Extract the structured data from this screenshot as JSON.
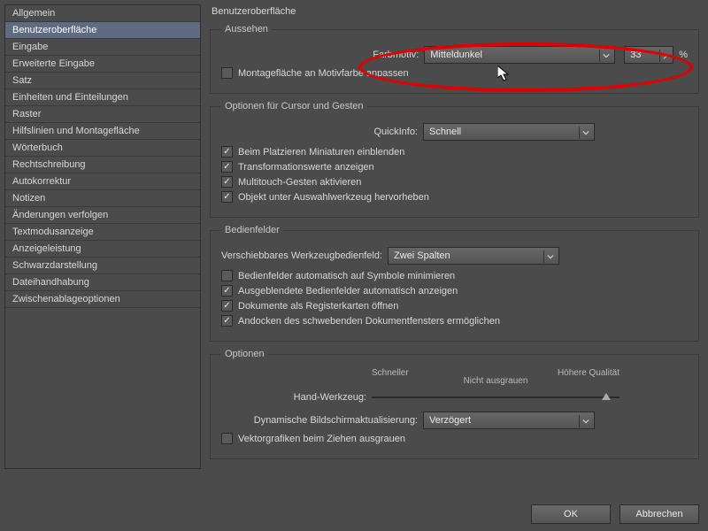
{
  "sidebar": {
    "items": [
      "Allgemein",
      "Benutzeroberfläche",
      "Eingabe",
      "Erweiterte Eingabe",
      "Satz",
      "Einheiten und Einteilungen",
      "Raster",
      "Hilfslinien und Montagefläche",
      "Wörterbuch",
      "Rechtschreibung",
      "Autokorrektur",
      "Notizen",
      "Änderungen verfolgen",
      "Textmodusanzeige",
      "Anzeigeleistung",
      "Schwarzdarstellung",
      "Dateihandhabung",
      "Zwischenablageoptionen"
    ],
    "selected_index": 1
  },
  "page_title": "Benutzeroberfläche",
  "appearance": {
    "legend": "Aussehen",
    "color_theme_label": "Farbmotiv:",
    "color_theme_value": "Mitteldunkel",
    "brightness_value": "33",
    "brightness_unit": "%",
    "match_pasteboard_label": "Montagefläche an Motivfarbe anpassen",
    "match_pasteboard_checked": false
  },
  "cursor": {
    "legend": "Optionen für Cursor und Gesten",
    "quickinfo_label": "QuickInfo:",
    "quickinfo_value": "Schnell",
    "checks": [
      {
        "label": "Beim Platzieren Miniaturen einblenden",
        "checked": true
      },
      {
        "label": "Transformationswerte anzeigen",
        "checked": true
      },
      {
        "label": "Multitouch-Gesten aktivieren",
        "checked": true
      },
      {
        "label": "Objekt unter Auswahlwerkzeug hervorheben",
        "checked": true
      }
    ]
  },
  "panels": {
    "legend": "Bedienfelder",
    "toolbar_label": "Verschiebbares Werkzeugbedienfeld:",
    "toolbar_value": "Zwei Spalten",
    "checks": [
      {
        "label": "Bedienfelder automatisch auf Symbole minimieren",
        "checked": false
      },
      {
        "label": "Ausgeblendete Bedienfelder automatisch anzeigen",
        "checked": true
      },
      {
        "label": "Dokumente als Registerkarten öffnen",
        "checked": true
      },
      {
        "label": "Andocken des schwebenden Dokumentfensters ermöglichen",
        "checked": true
      }
    ]
  },
  "options": {
    "legend": "Optionen",
    "slider_left": "Schneller",
    "slider_right": "Höhere Qualität",
    "slider_sub": "Nicht ausgrauen",
    "hand_tool_label": "Hand-Werkzeug:",
    "dynamic_label": "Dynamische Bildschirmaktualisierung:",
    "dynamic_value": "Verzögert",
    "greek_label": "Vektorgrafiken beim Ziehen ausgrauen",
    "greek_checked": false
  },
  "footer": {
    "ok": "OK",
    "cancel": "Abbrechen"
  }
}
